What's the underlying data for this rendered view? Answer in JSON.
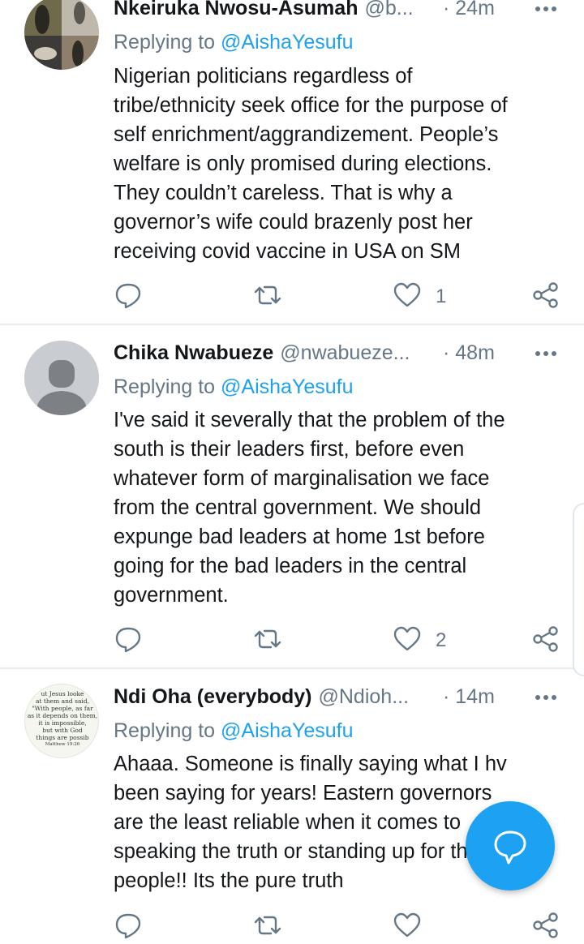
{
  "tweets": [
    {
      "name": "Nkeiruka Nwosu-Asumah",
      "handle": "@b...",
      "time": "· 24m",
      "replying_prefix": "Replying to ",
      "replying_to": "@AishaYesufu",
      "text_lines": [
        "Nigerian politicians regardless of",
        "tribe/ethnicity seek office for the purpose of",
        "self enrichment/aggrandizement. People’s",
        "welfare is only promised during elections.",
        "They couldn’t careless. That is why a",
        "governor’s wife could brazenly post her",
        "receiving covid vaccine in USA on SM"
      ],
      "likes": "1"
    },
    {
      "name": "Chika Nwabueze",
      "handle": "@nwabueze...",
      "time": "· 48m",
      "replying_prefix": "Replying to ",
      "replying_to": "@AishaYesufu",
      "text_lines": [
        "I've said it severally that the problem of the",
        "south is their leaders first, before even",
        "whatever form of marginalisation we face",
        "from the central government. We should",
        "expunge bad leaders at home 1st before",
        "going for the bad leaders in the central",
        "government."
      ],
      "likes": "2"
    },
    {
      "name": "Ndi Oha (everybody)",
      "handle": "@Ndioh...",
      "time": "· 14m",
      "replying_prefix": "Replying to ",
      "replying_to": "@AishaYesufu",
      "text_lines": [
        "Ahaaa. Someone is finally saying what I hv",
        "been saying for years! Eastern governors",
        "are the least reliable when it comes to",
        "speaking the truth or standing up for their",
        "people!! Its the pure truth"
      ],
      "avatar_text_lines": [
        "ut Jesus looke",
        "at them and said,",
        "\"With people, as far",
        "as it depends on them,",
        "it is impossible,",
        "but with God",
        "things are possib",
        "Matthew 19:26"
      ]
    }
  ],
  "icons": [
    "reply-icon",
    "retweet-icon",
    "like-icon",
    "share-icon",
    "more-icon",
    "compose-icon"
  ],
  "colors": {
    "accent": "#1da1f2",
    "muted": "#657786",
    "text": "#14171a",
    "divider": "#e6ecf0"
  }
}
